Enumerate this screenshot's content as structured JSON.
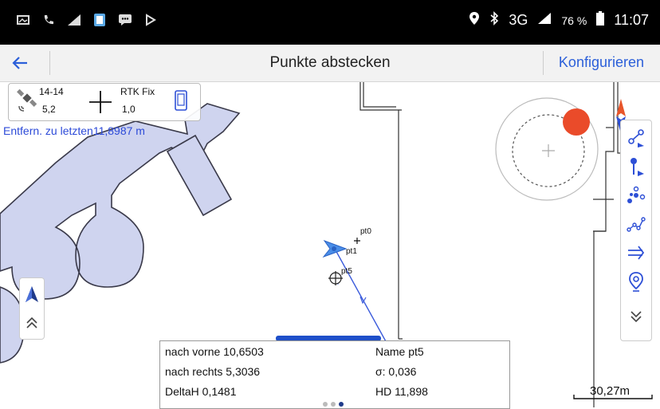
{
  "status_bar": {
    "left_icons": [
      "gallery-icon",
      "phone-icon",
      "signal-icon",
      "app-icon",
      "message-icon",
      "play-icon"
    ],
    "network": "3G",
    "battery": "76 %",
    "time": "11:07"
  },
  "app_bar": {
    "back_icon": "arrow-left-icon",
    "title": "Punkte abstecken",
    "configure": "Konfigurieren"
  },
  "gnss": {
    "satellites": "14-14",
    "pdop": "5,2",
    "fix": "RTK Fix",
    "precision": "1,0"
  },
  "distance_label": "Entfern. zu letzten11,8987 m",
  "map": {
    "points": [
      {
        "name": "pt0"
      },
      {
        "name": "pt1"
      },
      {
        "name": "pt5"
      }
    ],
    "colors": {
      "area_fill": "#cfd4ef",
      "area_stroke": "#3a3a4a",
      "route": "#3b5bdb",
      "target": "#ea4b2a"
    }
  },
  "right_tools": [
    "line-stakeout-icon",
    "point-stakeout-icon",
    "points-icon",
    "polyline-icon",
    "direction-arrow-icon",
    "location-pin-icon",
    "collapse-down-icon"
  ],
  "left_tools": [
    "north-arrow-icon",
    "expand-up-icon"
  ],
  "info": {
    "forward": "nach vorne 10,6503",
    "right": "nach rechts 5,3036",
    "delta_h": "DeltaH 0,1481",
    "name": "Name pt5",
    "sigma": "σ: 0,036",
    "hd": "HD 11,898"
  },
  "scale": "30,27m"
}
